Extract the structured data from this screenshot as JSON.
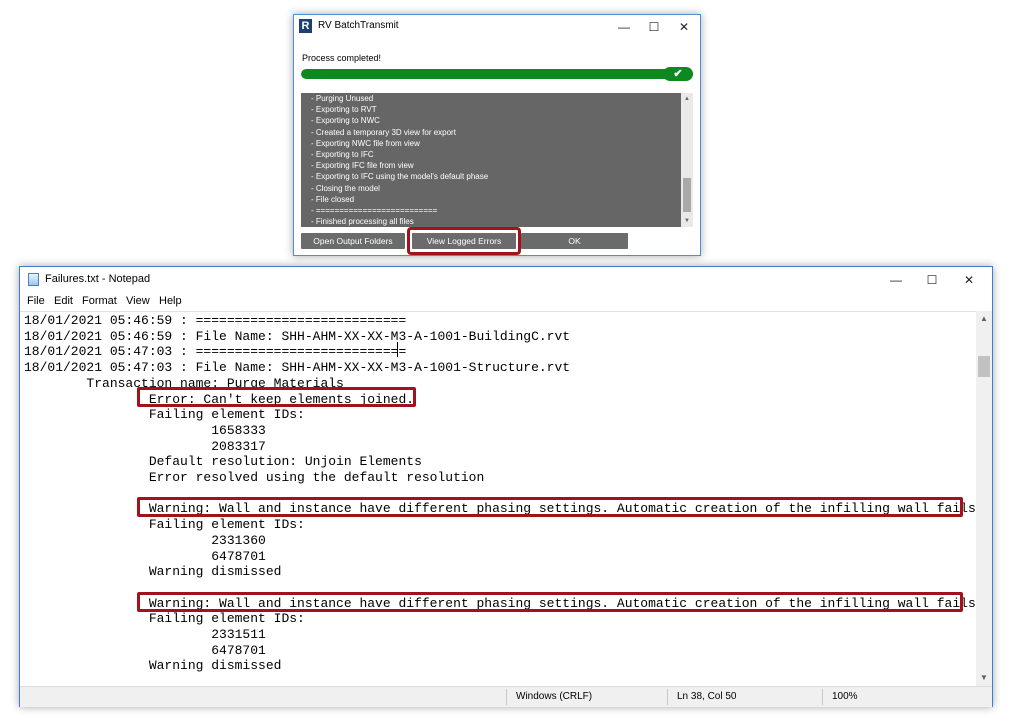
{
  "dialog": {
    "title": "RV BatchTransmit",
    "logo_letter": "R",
    "status": "Process completed!",
    "progress": 1.0,
    "log_lines": [
      "- Purging Unused",
      "- Exporting to RVT",
      "- Exporting to NWC",
      "- Created a temporary 3D view for export",
      "- Exporting NWC file from view",
      "- Exporting to IFC",
      "- Exporting IFC file from view",
      "- Exporting to IFC using the model's default phase",
      "- Closing the model",
      "- File closed",
      "- ==========================",
      "- Finished processing all files"
    ],
    "buttons": {
      "open_output": "Open Output Folders",
      "view_errors": "View Logged Errors",
      "ok": "OK"
    }
  },
  "notepad": {
    "title": "Failures.txt - Notepad",
    "menu": [
      "File",
      "Edit",
      "Format",
      "View",
      "Help"
    ],
    "lines": [
      "18/01/2021 05:46:59 : ===========================",
      "18/01/2021 05:46:59 : File Name: SHH-AHM-XX-XX-M3-A-1001-BuildingC.rvt",
      "18/01/2021 05:47:03 : ===========================",
      "18/01/2021 05:47:03 : File Name: SHH-AHM-XX-XX-M3-A-1001-Structure.rvt",
      "        Transaction name: Purge Materials",
      "                Error: Can't keep elements joined.",
      "                Failing element IDs:",
      "                        1658333",
      "                        2083317",
      "                Default resolution: Unjoin Elements",
      "                Error resolved using the default resolution",
      "",
      "                Warning: Wall and instance have different phasing settings. Automatic creation of the infilling wall fails.",
      "                Failing element IDs:",
      "                        2331360",
      "                        6478701",
      "                Warning dismissed",
      "",
      "                Warning: Wall and instance have different phasing settings. Automatic creation of the infilling wall fails.",
      "                Failing element IDs:",
      "                        2331511",
      "                        6478701",
      "                Warning dismissed"
    ],
    "status": {
      "encoding": "Windows (CRLF)",
      "position": "Ln 38, Col 50",
      "zoom": "100%"
    }
  },
  "colors": {
    "progress": "#0c8a1d",
    "highlight": "#a3111c",
    "log_background": "#666666"
  }
}
